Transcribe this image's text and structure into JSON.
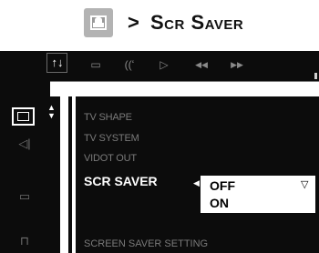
{
  "heading": {
    "arrow": ">",
    "title": "Scr Saver",
    "icon": "screen-saver-icon"
  },
  "toolbar": {
    "icons": [
      {
        "name": "settings-icon",
        "glyph": "↑↓"
      },
      {
        "name": "subtitle-icon",
        "glyph": "▭"
      },
      {
        "name": "audio-icon",
        "glyph": "((ʻ"
      },
      {
        "name": "play-icon",
        "glyph": "▷"
      },
      {
        "name": "rewind-icon",
        "glyph": "◀◀"
      },
      {
        "name": "fast-forward-icon",
        "glyph": "▶▶"
      }
    ]
  },
  "sidebar": {
    "icons": [
      {
        "name": "tv-settings-icon",
        "glyph": "▣",
        "selected": true
      },
      {
        "name": "speaker-icon",
        "glyph": "◁|"
      },
      {
        "name": "chat-icon",
        "glyph": "▭"
      },
      {
        "name": "preferences-icon",
        "glyph": "⊓"
      }
    ]
  },
  "menu": {
    "items": [
      {
        "label": "TV SHAPE"
      },
      {
        "label": "TV SYSTEM"
      },
      {
        "label": "VIDOT OUT"
      }
    ],
    "selected": "SCR SAVER",
    "footer": "SCREEN SAVER SETTING"
  },
  "submenu": {
    "options": [
      "OFF",
      "ON"
    ],
    "highlighted": "OFF"
  },
  "colors": {
    "background": "#0c0c0c",
    "active_text": "#ffffff",
    "inactive_text": "#7a7a7a",
    "heading_icon": "#b3b3b3"
  }
}
